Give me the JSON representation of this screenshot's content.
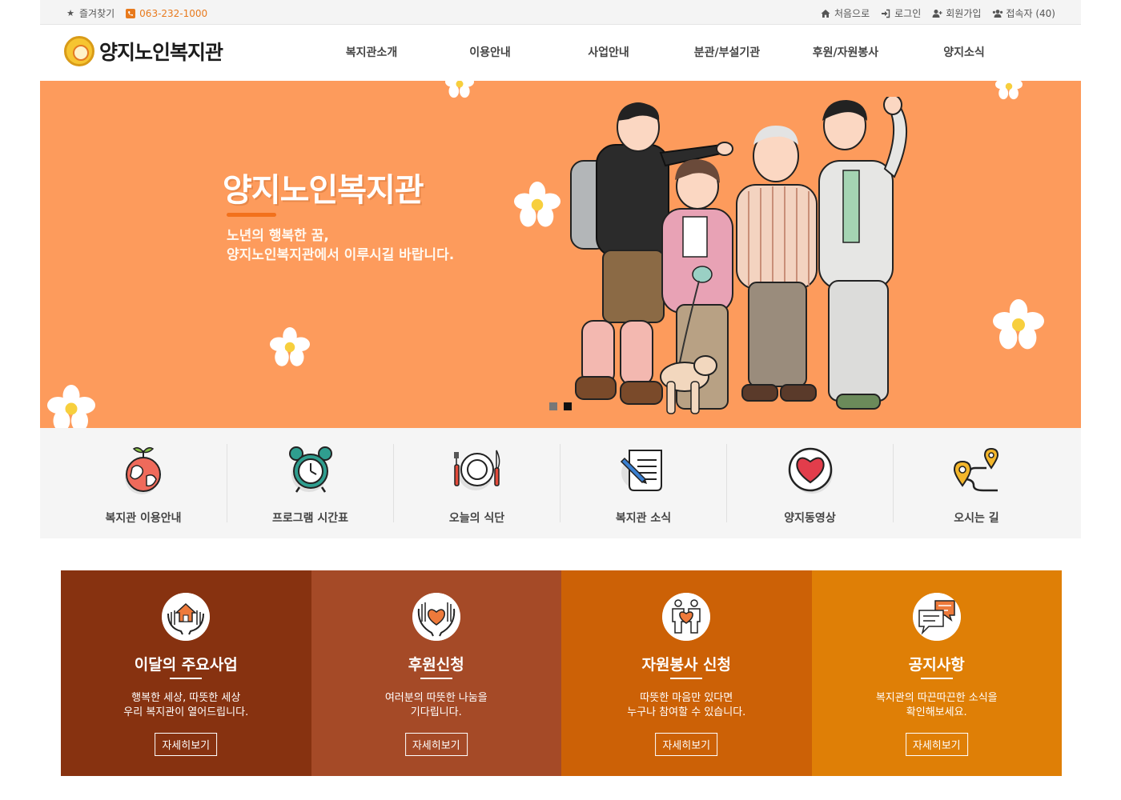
{
  "topbar": {
    "bookmark": "즐겨찾기",
    "phone": "063-232-1000",
    "home": "처음으로",
    "login": "로그인",
    "join": "회원가입",
    "visitors": "접속자 (40)"
  },
  "header": {
    "logo_text": "양지노인복지관",
    "nav": [
      "복지관소개",
      "이용안내",
      "사업안내",
      "분관/부설기관",
      "후원/자원봉사",
      "양지소식"
    ]
  },
  "hero": {
    "title": "양지노인복지관",
    "subtitle_line1": "노년의 행복한 꿈,",
    "subtitle_line2": "양지노인복지관에서 이루시길 바랍니다.",
    "slide_count": 2,
    "active_slide": 2,
    "background_color": "#fd9b5c"
  },
  "quick_menu": [
    {
      "label": "복지관 이용안내",
      "icon": "globe-sprout-icon"
    },
    {
      "label": "프로그램 시간표",
      "icon": "alarm-clock-icon"
    },
    {
      "label": "오늘의 식단",
      "icon": "plate-cutlery-icon"
    },
    {
      "label": "복지관 소식",
      "icon": "newspaper-pen-icon"
    },
    {
      "label": "양지동영상",
      "icon": "heart-icon"
    },
    {
      "label": "오시는 길",
      "icon": "route-pin-icon"
    }
  ],
  "features": [
    {
      "title": "이달의 주요사업",
      "desc1": "행복한 세상, 따뜻한 세상",
      "desc2": "우리 복지관이 열어드립니다.",
      "button": "자세히보기",
      "color": "#873210",
      "icon": "hands-house-icon"
    },
    {
      "title": "후원신청",
      "desc1": "여러분의 따뜻한 나눔을",
      "desc2": "기다립니다.",
      "button": "자세히보기",
      "color": "#a54a27",
      "icon": "hands-heart-icon"
    },
    {
      "title": "자원봉사 신청",
      "desc1": "따뜻한 마음만 있다면",
      "desc2": "누구나 참여할 수 있습니다.",
      "button": "자세히보기",
      "color": "#cc6106",
      "icon": "volunteers-heart-icon"
    },
    {
      "title": "공지사항",
      "desc1": "복지관의 따끈따끈한 소식을",
      "desc2": "확인해보세요.",
      "button": "자세히보기",
      "color": "#df7f06",
      "icon": "speech-bubbles-icon"
    }
  ]
}
